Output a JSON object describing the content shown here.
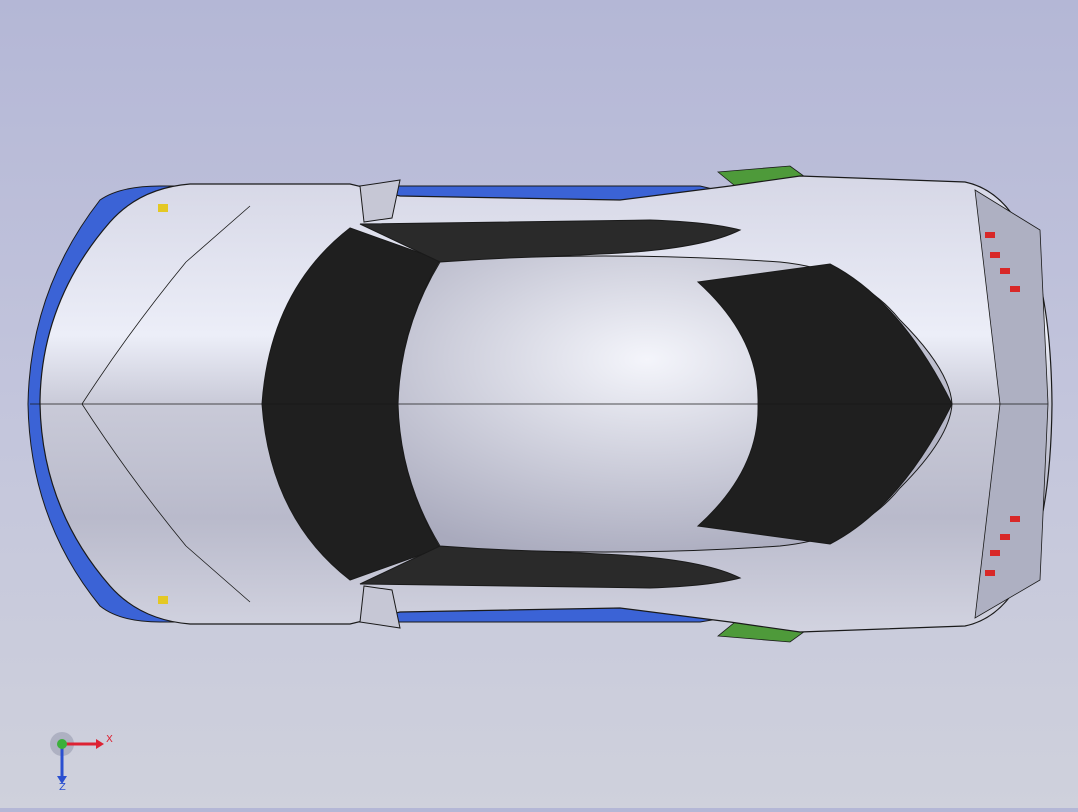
{
  "viewport": {
    "background_top": "#b4b7d6",
    "background_bottom": "#cfd1dc",
    "model": "car-body-top-view",
    "colors": {
      "body": "#c9cad8",
      "body_highlight": "#eceef8",
      "glass": "#1f1f1f",
      "underbody": "#3b63d6",
      "vent_green": "#4e9a3a",
      "vent_red": "#d82828",
      "edge": "#1a1a1a"
    }
  },
  "triad": {
    "x_label": "X",
    "z_label": "Z",
    "icon": "coordinate-triad-icon"
  }
}
